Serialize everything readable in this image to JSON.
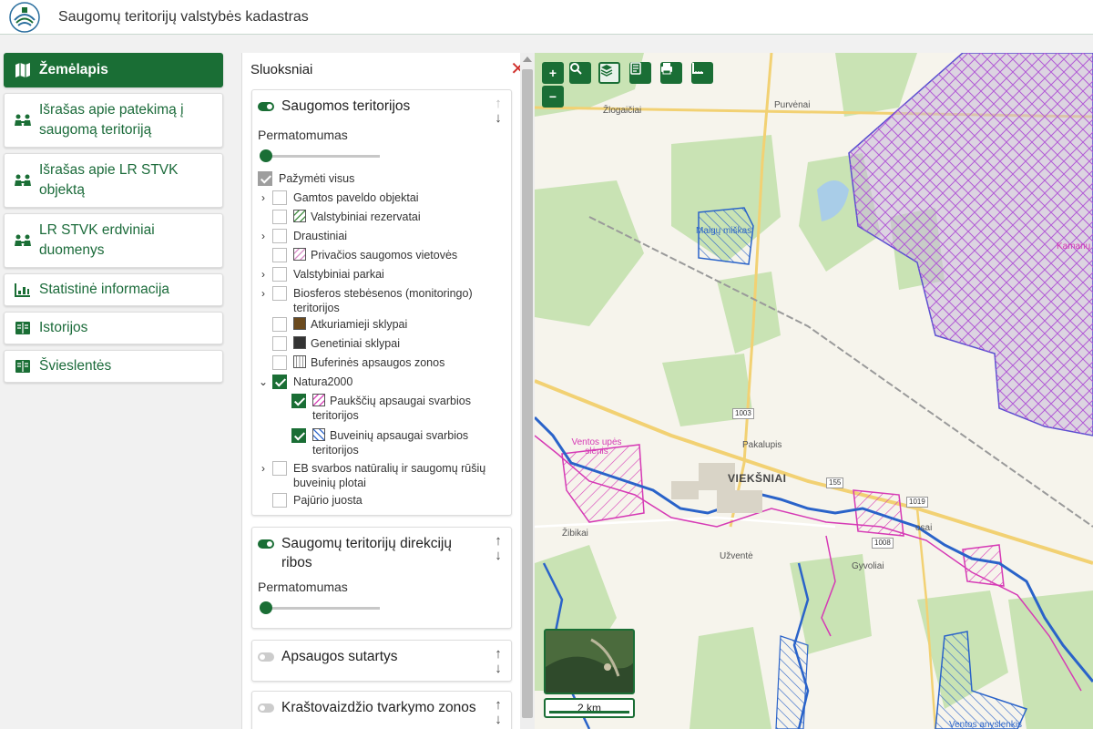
{
  "header": {
    "title": "Saugomų teritorijų valstybės kadastras",
    "logo_icon": "cadastre-emblem-icon"
  },
  "nav": [
    {
      "label": "Žemėlapis",
      "icon": "map-icon",
      "active": true
    },
    {
      "label": "Išrašas apie patekimą į saugomą teritoriją",
      "icon": "people-icon"
    },
    {
      "label": "Išrašas apie LR STVK objektą",
      "icon": "people-icon"
    },
    {
      "label": "LR STVK erdviniai duomenys",
      "icon": "people-icon"
    },
    {
      "label": "Statistinė informacija",
      "icon": "chart-icon"
    },
    {
      "label": "Istorijos",
      "icon": "book-icon"
    },
    {
      "label": "Švieslentės",
      "icon": "book-icon"
    }
  ],
  "layers_panel": {
    "title": "Sluoksniai",
    "cards": [
      {
        "title": "Saugomos teritorijos",
        "enabled": true,
        "opacity_label": "Permatomumas",
        "select_all": "Pažymėti visus",
        "items": [
          {
            "label": "Gamtos paveldo objektai",
            "expandable": true,
            "checked": false
          },
          {
            "label": "Valstybiniai rezervatai",
            "checked": false,
            "swatch": "hatch-green"
          },
          {
            "label": "Draustiniai",
            "expandable": true,
            "checked": false
          },
          {
            "label": "Privačios saugomos vietovės",
            "checked": false,
            "swatch": "hatch-pink"
          },
          {
            "label": "Valstybiniai parkai",
            "expandable": true,
            "checked": false
          },
          {
            "label": "Biosferos stebėsenos (monitoringo) teritorijos",
            "expandable": true,
            "checked": false
          },
          {
            "label": "Atkuriamieji sklypai",
            "checked": false,
            "swatch": "#6b4a1e"
          },
          {
            "label": "Genetiniai sklypai",
            "checked": false,
            "swatch": "#333333"
          },
          {
            "label": "Buferinės apsaugos zonos",
            "checked": false,
            "swatch": "lines-grey"
          },
          {
            "label": "Natura2000",
            "expanded": true,
            "checked": true
          },
          {
            "label": "Paukščių apsaugai svarbios teritorijos",
            "checked": true,
            "swatch": "hatch-magenta"
          },
          {
            "label": "Buveinių apsaugai svarbios teritorijos",
            "checked": true,
            "swatch": "hatch-blue"
          },
          {
            "label": "EB svarbos natūralių ir saugomų rūšių buveinių plotai",
            "expandable": true,
            "checked": false
          },
          {
            "label": "Pajūrio juosta",
            "checked": false
          }
        ]
      },
      {
        "title": "Saugomų teritorijų direkcijų ribos",
        "enabled": true,
        "opacity_label": "Permatomumas"
      },
      {
        "title": "Apsaugos sutartys",
        "enabled": false
      },
      {
        "title": "Kraštovaizdžio tvarkymo zonos",
        "enabled": false
      }
    ]
  },
  "map": {
    "toolbar": {
      "zoom_in": "+",
      "zoom_out": "−",
      "tools": [
        "search-icon",
        "layers-icon",
        "legend-icon",
        "print-icon",
        "measure-icon"
      ]
    },
    "places": {
      "zlogaiciai": "Žlogaičiai",
      "purvenai": "Purvėnai",
      "maigu_miskas": "Maigų miškas",
      "kamanu": "Kamanų",
      "pakalupis": "Pakalupis",
      "vieksniai": "VIEKŠNIAI",
      "ventos_upes_slenis": "Ventos upės slėnis",
      "zibikai": "Žibikai",
      "uzvente": "Užventė",
      "gyvoliai": "Gyvoliai",
      "sosai": "osai",
      "ventos_anyslenkis": "Ventos anyslenkis"
    },
    "roads": {
      "r1003": "1003",
      "r155": "155",
      "r1019": "1019",
      "r1008": "1008"
    },
    "scale": "2 km",
    "colors": {
      "forest": "#c9e3b4",
      "field": "#f6f4ec",
      "bird_area": "#d63ab5",
      "habitat_area": "#2a63c9",
      "accent": "#1a6e35"
    }
  }
}
